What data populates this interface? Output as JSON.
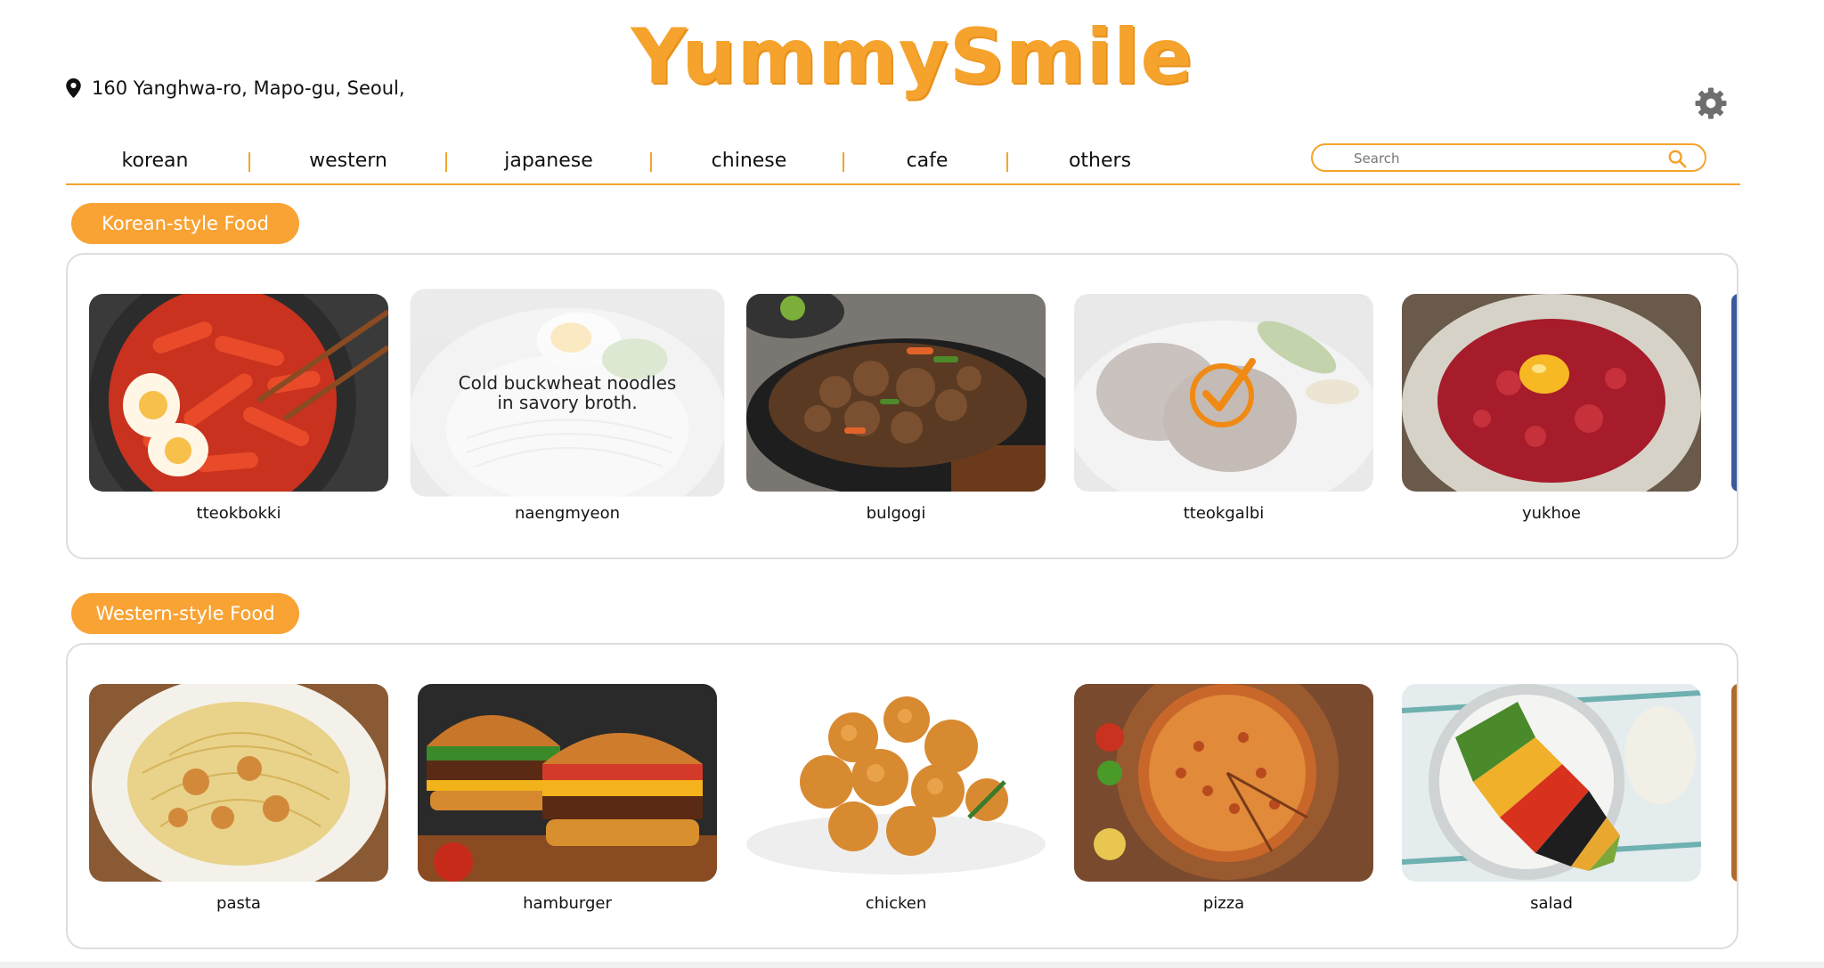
{
  "app": {
    "logo": "YummySmile"
  },
  "header": {
    "address": "160 Yanghwa-ro, Mapo-gu, Seoul,"
  },
  "nav": {
    "items": [
      "korean",
      "western",
      "japanese",
      "chinese",
      "cafe",
      "others"
    ],
    "search_placeholder": "Search"
  },
  "sections": [
    {
      "title": "Korean-style Food",
      "items": [
        {
          "name": "tteokbokki"
        },
        {
          "name": "naengmyeon",
          "description": "Cold buckwheat noodles in savory broth."
        },
        {
          "name": "bulgogi"
        },
        {
          "name": "tteokgalbi",
          "selected": true
        },
        {
          "name": "yukhoe"
        }
      ]
    },
    {
      "title": "Western-style Food",
      "items": [
        {
          "name": "pasta"
        },
        {
          "name": "hamburger"
        },
        {
          "name": "chicken"
        },
        {
          "name": "pizza"
        },
        {
          "name": "salad"
        }
      ]
    }
  ],
  "colors": {
    "accent": "#f5a32c",
    "pill": "#f8a334",
    "border": "#dddddd"
  },
  "icons": [
    "map-pin-icon",
    "gear-icon",
    "search-icon",
    "check-circle-icon"
  ]
}
